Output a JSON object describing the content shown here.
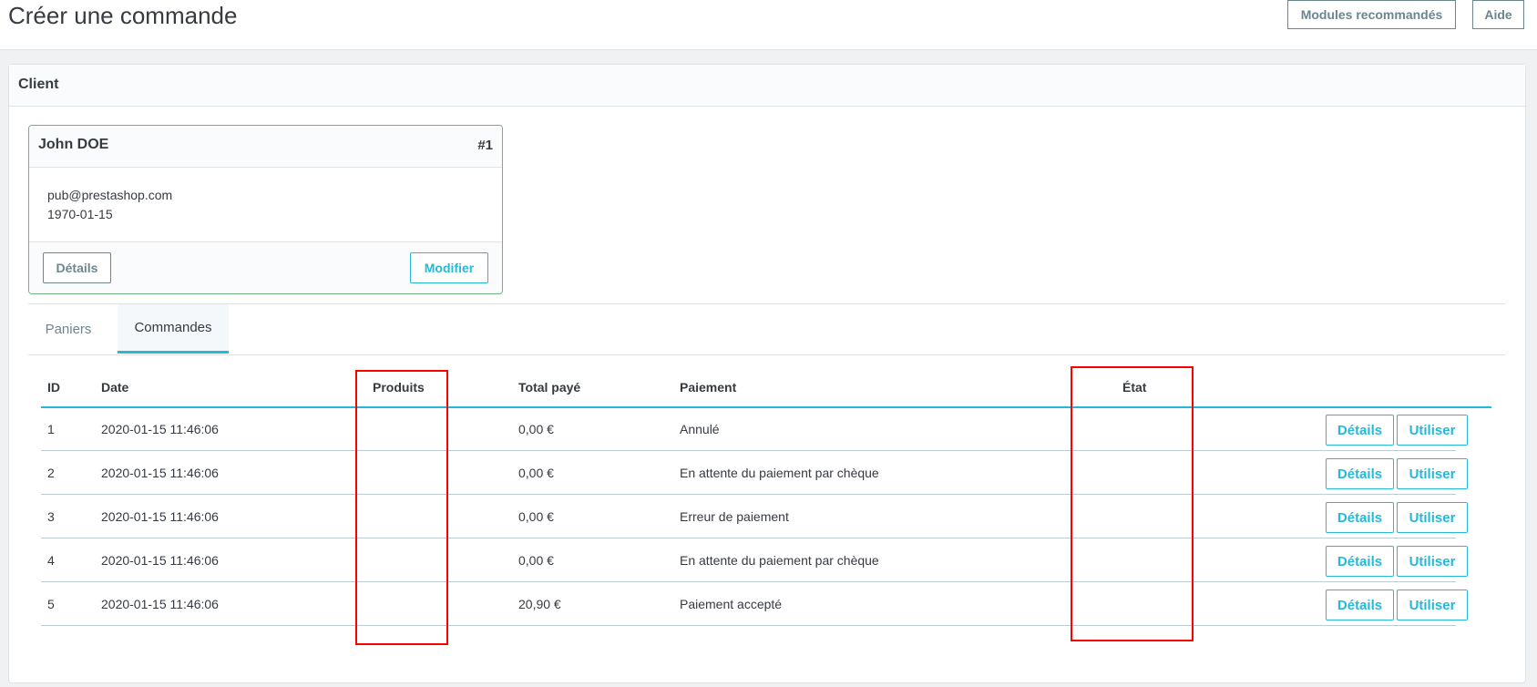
{
  "header": {
    "title": "Créer une commande",
    "buttons": {
      "modules": "Modules recommandés",
      "help": "Aide"
    }
  },
  "customer_panel": {
    "title": "Client",
    "card": {
      "name": "John DOE",
      "id": "#1",
      "email": "pub@prestashop.com",
      "birthday": "1970-01-15",
      "details_label": "Détails",
      "edit_label": "Modifier"
    },
    "tabs": [
      {
        "label": "Paniers",
        "active": false
      },
      {
        "label": "Commandes",
        "active": true
      }
    ]
  },
  "orders": {
    "columns": {
      "id": "ID",
      "date": "Date",
      "products": "Produits",
      "total": "Total payé",
      "payment": "Paiement",
      "state": "État"
    },
    "rows": [
      {
        "id": "1",
        "date": "2020-01-15 11:46:06",
        "products": "",
        "total": "0,00 €",
        "payment": "Annulé",
        "state": ""
      },
      {
        "id": "2",
        "date": "2020-01-15 11:46:06",
        "products": "",
        "total": "0,00 €",
        "payment": "En attente du paiement par chèque",
        "state": ""
      },
      {
        "id": "3",
        "date": "2020-01-15 11:46:06",
        "products": "",
        "total": "0,00 €",
        "payment": "Erreur de paiement",
        "state": ""
      },
      {
        "id": "4",
        "date": "2020-01-15 11:46:06",
        "products": "",
        "total": "0,00 €",
        "payment": "En attente du paiement par chèque",
        "state": ""
      },
      {
        "id": "5",
        "date": "2020-01-15 11:46:06",
        "products": "",
        "total": "20,90 €",
        "payment": "Paiement accepté",
        "state": ""
      }
    ],
    "row_actions": {
      "details": "Détails",
      "use": "Utiliser"
    }
  },
  "colors": {
    "accent": "#25b9d7",
    "secondary": "#6c868e",
    "card_border": "#70b580",
    "highlight": "#ff0000"
  }
}
